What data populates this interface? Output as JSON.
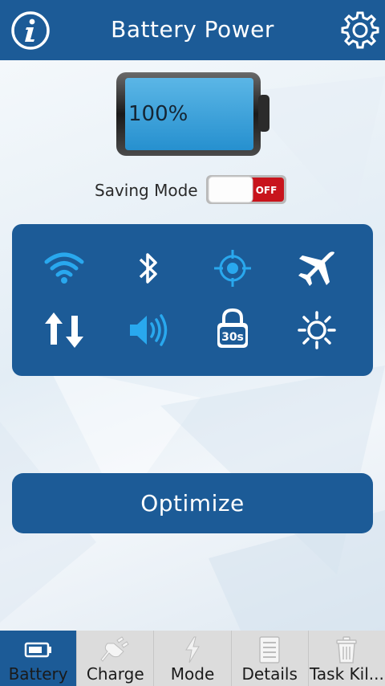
{
  "header": {
    "title": "Battery Power",
    "info_icon": "info-icon",
    "settings_icon": "gear-icon"
  },
  "battery": {
    "level_text": "100%",
    "level": 1.0
  },
  "saving_mode": {
    "label": "Saving Mode",
    "state": "OFF"
  },
  "quick_settings": [
    {
      "icon": "wifi-icon",
      "active": true
    },
    {
      "icon": "bluetooth-icon",
      "active": false
    },
    {
      "icon": "gps-icon",
      "active": true
    },
    {
      "icon": "airplane-icon",
      "active": false
    },
    {
      "icon": "mobile-data-icon",
      "active": false
    },
    {
      "icon": "volume-icon",
      "active": true
    },
    {
      "icon": "screen-timeout-icon",
      "value": "30s"
    },
    {
      "icon": "brightness-icon",
      "active": false
    }
  ],
  "optimize_label": "Optimize",
  "tabs": [
    {
      "label": "Battery",
      "icon": "battery-icon",
      "active": true
    },
    {
      "label": "Charge",
      "icon": "plug-icon",
      "active": false
    },
    {
      "label": "Mode",
      "icon": "lightning-icon",
      "active": false
    },
    {
      "label": "Details",
      "icon": "list-icon",
      "active": false
    },
    {
      "label": "Task Kil...",
      "icon": "trash-icon",
      "active": false
    }
  ],
  "colors": {
    "primary": "#1c5b97",
    "accent_on": "#29a8ee",
    "toggle_off": "#c8141c"
  }
}
